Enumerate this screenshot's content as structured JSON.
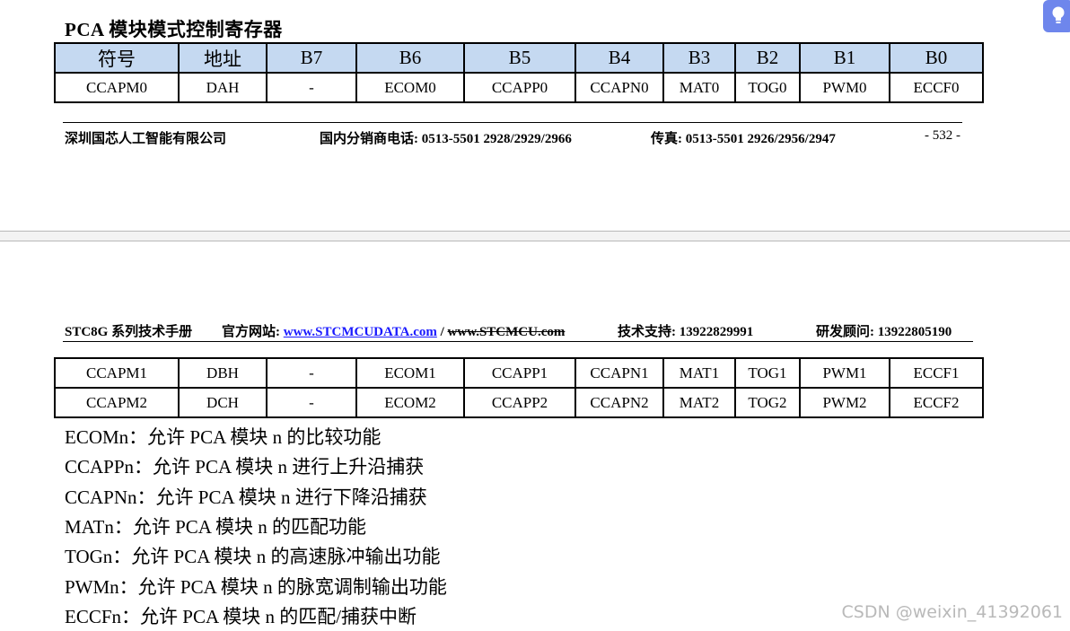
{
  "section_title": "PCA 模块模式控制寄存器",
  "table_headers": [
    "符号",
    "地址",
    "B7",
    "B6",
    "B5",
    "B4",
    "B3",
    "B2",
    "B1",
    "B0"
  ],
  "register_rows": [
    [
      "CCAPM0",
      "DAH",
      "-",
      "ECOM0",
      "CCAPP0",
      "CCAPN0",
      "MAT0",
      "TOG0",
      "PWM0",
      "ECCF0"
    ],
    [
      "CCAPM1",
      "DBH",
      "-",
      "ECOM1",
      "CCAPP1",
      "CCAPN1",
      "MAT1",
      "TOG1",
      "PWM1",
      "ECCF1"
    ],
    [
      "CCAPM2",
      "DCH",
      "-",
      "ECOM2",
      "CCAPP2",
      "CCAPN2",
      "MAT2",
      "TOG2",
      "PWM2",
      "ECCF2"
    ]
  ],
  "footer": {
    "company": "深圳国芯人工智能有限公司",
    "phone": "国内分销商电话: 0513-5501 2928/2929/2966",
    "fax": "传真: 0513-5501 2926/2956/2947",
    "page": "- 532 -"
  },
  "header": {
    "manual": "STC8G 系列技术手册",
    "site_label": "官方网站: ",
    "site_link": "www.STCMCUDATA.com",
    "separator": " / ",
    "site_old": "www.STCMCU.com",
    "support": "技术支持: 13922829991",
    "consultant": "研发顾问: 13922805190"
  },
  "descriptions": [
    "ECOMn：允许 PCA 模块 n 的比较功能",
    "CCAPPn：允许 PCA 模块 n 进行上升沿捕获",
    "CCAPNn：允许 PCA 模块 n 进行下降沿捕获",
    "MATn：允许 PCA 模块 n 的匹配功能",
    "TOGn：允许 PCA 模块 n 的高速脉冲输出功能",
    "PWMn：允许 PCA 模块 n 的脉宽调制输出功能",
    "ECCFn：允许 PCA 模块 n 的匹配/捕获中断"
  ],
  "watermark": "CSDN @weixin_41392061",
  "icons": {
    "hint": "lightbulb-icon"
  },
  "colors": {
    "table_header_bg": "#c5d9f1",
    "link": "#1a1aff",
    "hint_button": "#6e86ec"
  }
}
